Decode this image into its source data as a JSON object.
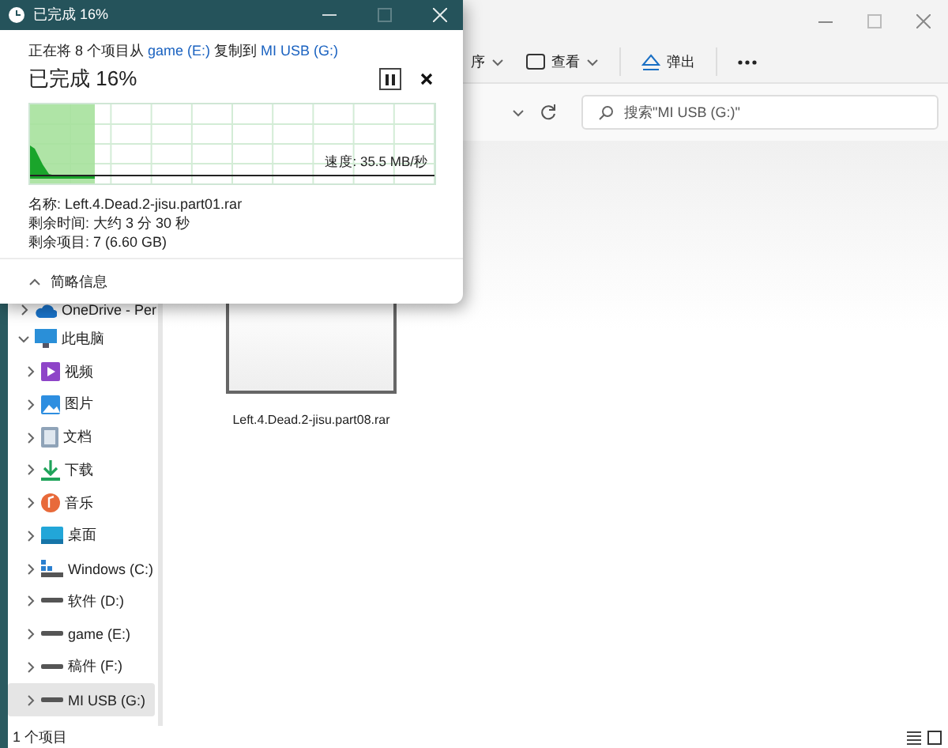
{
  "explorer": {
    "toolbar": [
      {
        "kind": "menu",
        "label": "序"
      },
      {
        "kind": "view",
        "label": "查看"
      },
      {
        "kind": "eject",
        "label": "弹出"
      },
      {
        "kind": "more"
      }
    ],
    "search": {
      "placeholder": "搜索\"MI USB (G:)\""
    },
    "sidebar": {
      "items": [
        {
          "kind": "cloud",
          "label": "OneDrive - Per",
          "expanded": false,
          "selected": false
        },
        {
          "kind": "pc",
          "label": "此电脑",
          "expanded": true,
          "selected": false,
          "children": [
            {
              "kind": "video",
              "label": "视频",
              "expanded": false,
              "selected": false
            },
            {
              "kind": "picture",
              "label": "图片",
              "expanded": false,
              "selected": false
            },
            {
              "kind": "document",
              "label": "文档",
              "expanded": false,
              "selected": false
            },
            {
              "kind": "download",
              "label": "下载",
              "expanded": false,
              "selected": false
            },
            {
              "kind": "music",
              "label": "音乐",
              "expanded": false,
              "selected": false
            },
            {
              "kind": "desktop",
              "label": "桌面",
              "expanded": false,
              "selected": false
            },
            {
              "kind": "system-drive",
              "label": "Windows (C:)",
              "expanded": false,
              "selected": false
            },
            {
              "kind": "drive",
              "label": "软件 (D:)",
              "expanded": false,
              "selected": false
            },
            {
              "kind": "drive",
              "label": "game (E:)",
              "expanded": false,
              "selected": false
            },
            {
              "kind": "drive",
              "label": "稿件 (F:)",
              "expanded": false,
              "selected": false
            },
            {
              "kind": "drive",
              "label": "MI USB (G:)",
              "expanded": false,
              "selected": true
            }
          ]
        }
      ]
    },
    "files": [
      {
        "name": "Left.4.Dead.2-jisu.part08.rar"
      }
    ],
    "status_bar": "1 个项目"
  },
  "copy_dialog": {
    "title": "已完成 16%",
    "status_parts": [
      {
        "kind": "text",
        "text": "正在将 8 个项目从 "
      },
      {
        "kind": "link",
        "text": "game (E:)"
      },
      {
        "kind": "text",
        "text": " 复制到 "
      },
      {
        "kind": "link",
        "text": "MI USB (G:)"
      }
    ],
    "heading": "已完成 16%",
    "level": 0.16,
    "speed": "速度: 35.5 MB/秒",
    "details": [
      "名称: Left.4.Dead.2-jisu.part01.rar",
      "剩余时间: 大约 3 分 30 秒",
      "剩余项目: 7 (6.60 GB)"
    ],
    "details_toggle": {
      "label": "简略信息",
      "expanded": true
    }
  }
}
